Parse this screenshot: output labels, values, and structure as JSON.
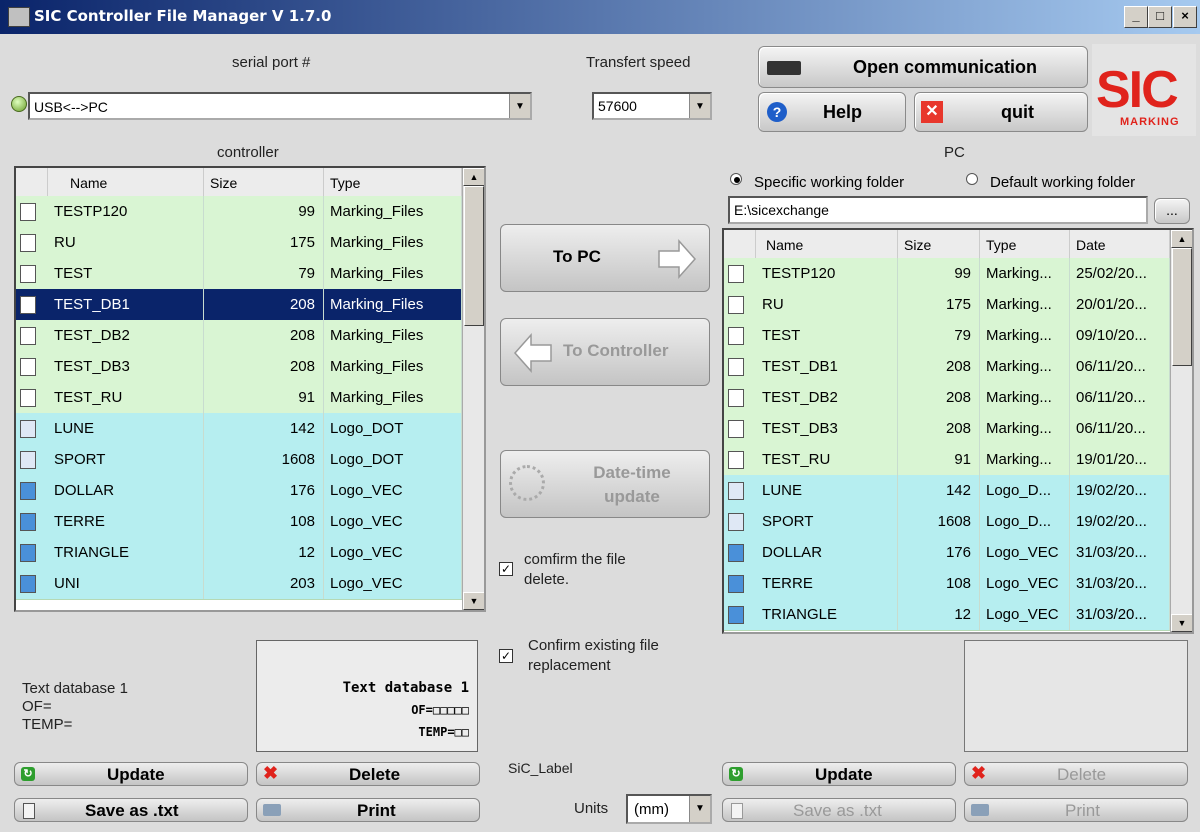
{
  "window": {
    "title": "SIC Controller File Manager V 1.7.0",
    "btn_min": "_",
    "btn_max": "□",
    "btn_close": "×"
  },
  "top": {
    "serial_port_label": "serial port #",
    "serial_port_value": "USB<-->PC",
    "speed_label": "Transfert speed",
    "speed_value": "57600",
    "open_comm_label": "Open communication",
    "help_label": "Help",
    "quit_label": "quit",
    "logo_text": "SIC",
    "logo_sub": "MARKING"
  },
  "controller": {
    "title": "controller",
    "columns": [
      "Name",
      "Size",
      "Type"
    ],
    "rows": [
      {
        "name": "TESTP120",
        "size": "99",
        "type": "Marking_Files",
        "kind": "file"
      },
      {
        "name": "RU",
        "size": "175",
        "type": "Marking_Files",
        "kind": "file"
      },
      {
        "name": "TEST",
        "size": "79",
        "type": "Marking_Files",
        "kind": "file"
      },
      {
        "name": "TEST_DB1",
        "size": "208",
        "type": "Marking_Files",
        "kind": "file",
        "selected": true
      },
      {
        "name": "TEST_DB2",
        "size": "208",
        "type": "Marking_Files",
        "kind": "file"
      },
      {
        "name": "TEST_DB3",
        "size": "208",
        "type": "Marking_Files",
        "kind": "file"
      },
      {
        "name": "TEST_RU",
        "size": "91",
        "type": "Marking_Files",
        "kind": "file"
      },
      {
        "name": "LUNE",
        "size": "142",
        "type": "Logo_DOT",
        "kind": "dot"
      },
      {
        "name": "SPORT",
        "size": "1608",
        "type": "Logo_DOT",
        "kind": "dot"
      },
      {
        "name": "DOLLAR",
        "size": "176",
        "type": "Logo_VEC",
        "kind": "vec"
      },
      {
        "name": "TERRE",
        "size": "108",
        "type": "Logo_VEC",
        "kind": "vec"
      },
      {
        "name": "TRIANGLE",
        "size": "12",
        "type": "Logo_VEC",
        "kind": "vec"
      },
      {
        "name": "UNI",
        "size": "203",
        "type": "Logo_VEC",
        "kind": "vec"
      }
    ]
  },
  "middle": {
    "to_pc": "To PC",
    "to_controller": "To Controller",
    "date_time_1": "Date-time",
    "date_time_2": "update",
    "confirm_delete_1": "comfirm the file",
    "confirm_delete_2": "delete.",
    "confirm_replace_1": "Confirm existing file",
    "confirm_replace_2": "replacement",
    "sic_label": "SiC_Label",
    "units_label": "Units",
    "units_value": "(mm)",
    "check_mark": "✓"
  },
  "pc": {
    "title": "PC",
    "radio_specific": "Specific working folder",
    "radio_default": "Default working folder",
    "path": "E:\\sicexchange",
    "browse": "...",
    "columns": [
      "Name",
      "Size",
      "Type",
      "Date"
    ],
    "rows": [
      {
        "name": "TESTP120",
        "size": "99",
        "type": "Marking...",
        "date": "25/02/20...",
        "kind": "file"
      },
      {
        "name": "RU",
        "size": "175",
        "type": "Marking...",
        "date": "20/01/20...",
        "kind": "file"
      },
      {
        "name": "TEST",
        "size": "79",
        "type": "Marking...",
        "date": "09/10/20...",
        "kind": "file"
      },
      {
        "name": "TEST_DB1",
        "size": "208",
        "type": "Marking...",
        "date": "06/11/20...",
        "kind": "file"
      },
      {
        "name": "TEST_DB2",
        "size": "208",
        "type": "Marking...",
        "date": "06/11/20...",
        "kind": "file"
      },
      {
        "name": "TEST_DB3",
        "size": "208",
        "type": "Marking...",
        "date": "06/11/20...",
        "kind": "file"
      },
      {
        "name": "TEST_RU",
        "size": "91",
        "type": "Marking...",
        "date": "19/01/20...",
        "kind": "file"
      },
      {
        "name": "LUNE",
        "size": "142",
        "type": "Logo_D...",
        "date": "19/02/20...",
        "kind": "dot"
      },
      {
        "name": "SPORT",
        "size": "1608",
        "type": "Logo_D...",
        "date": "19/02/20...",
        "kind": "dot"
      },
      {
        "name": "DOLLAR",
        "size": "176",
        "type": "Logo_VEC",
        "date": "31/03/20...",
        "kind": "vec"
      },
      {
        "name": "TERRE",
        "size": "108",
        "type": "Logo_VEC",
        "date": "31/03/20...",
        "kind": "vec"
      },
      {
        "name": "TRIANGLE",
        "size": "12",
        "type": "Logo_VEC",
        "date": "31/03/20...",
        "kind": "vec"
      }
    ]
  },
  "preview": {
    "left_line1": "Text database 1",
    "left_line2": "OF=",
    "left_line3": "TEMP=",
    "box_line1": "Text database 1",
    "box_line2": "OF=□□□□□",
    "box_line3": "TEMP=□□"
  },
  "bottom": {
    "update": "Update",
    "delete": "Delete",
    "save_txt": "Save as .txt",
    "print": "Print"
  },
  "colors": {
    "green_row": "#d9f5d3",
    "cyan_row": "#b6eef0",
    "selected": "#0a246a"
  }
}
